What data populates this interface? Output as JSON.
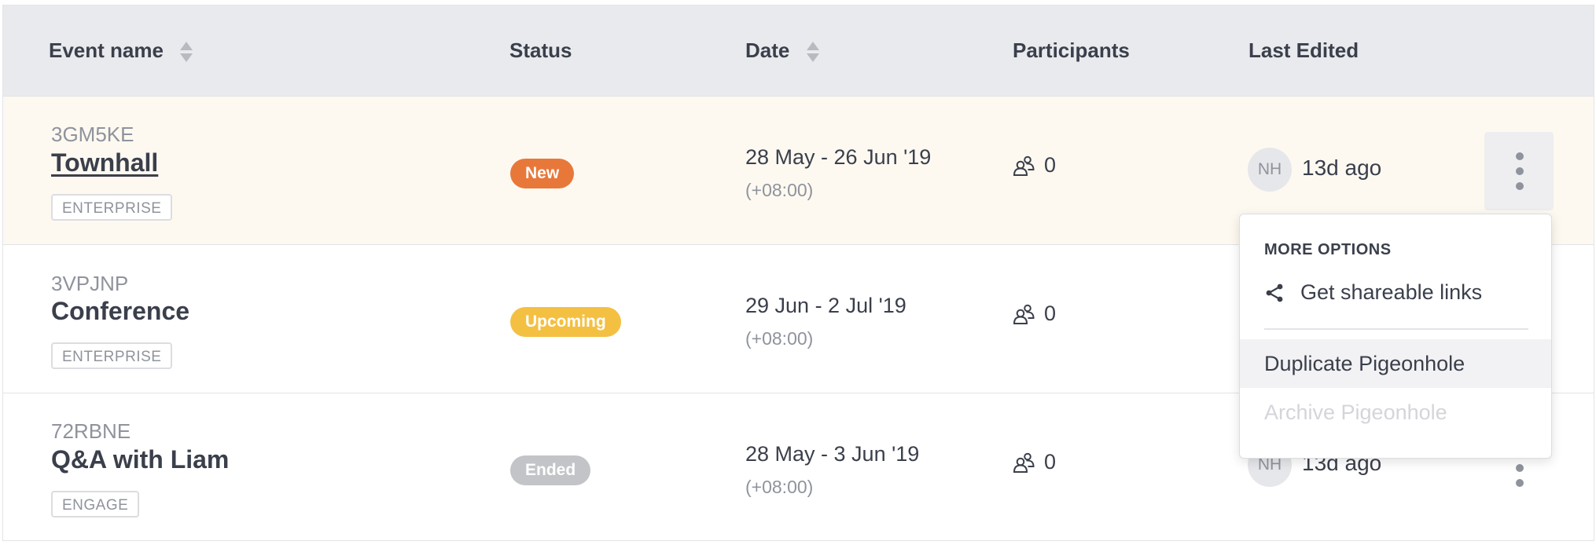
{
  "table": {
    "headers": {
      "event_name": "Event name",
      "status": "Status",
      "date": "Date",
      "participants": "Participants",
      "last_edited": "Last Edited"
    },
    "rows": [
      {
        "code": "3GM5KE",
        "name": "Townhall",
        "plan": "ENTERPRISE",
        "status": "New",
        "status_color": "#e8783a",
        "date": "28 May - 26 Jun '19",
        "timezone": "(+08:00)",
        "participants": "0",
        "editor_initials": "NH",
        "last_edited": "13d ago"
      },
      {
        "code": "3VPJNP",
        "name": "Conference",
        "plan": "ENTERPRISE",
        "status": "Upcoming",
        "status_color": "#f4c042",
        "date": "29 Jun - 2 Jul '19",
        "timezone": "(+08:00)",
        "participants": "0"
      },
      {
        "code": "72RBNE",
        "name": "Q&A with Liam",
        "plan": "ENGAGE",
        "status": "Ended",
        "status_color": "#c3c4c8",
        "date": "28 May - 3 Jun '19",
        "timezone": "(+08:00)",
        "participants": "0",
        "editor_initials": "NH",
        "last_edited": "13d ago"
      }
    ]
  },
  "menu": {
    "header": "MORE OPTIONS",
    "share_label": "Get shareable links",
    "duplicate_label": "Duplicate Pigeonhole",
    "archive_label": "Archive Pigeonhole"
  },
  "icons": {
    "sort": "sort-arrows-icon",
    "participants": "users-icon",
    "more": "kebab-menu-icon",
    "share": "share-icon"
  }
}
